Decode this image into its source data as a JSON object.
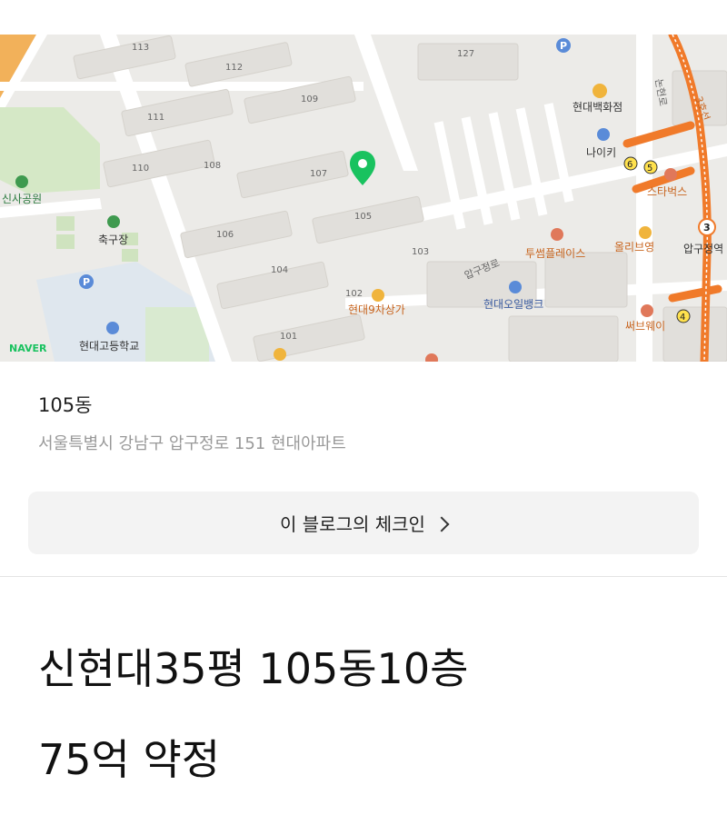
{
  "map": {
    "brand": "NAVER",
    "buildings": [
      "113",
      "112",
      "127",
      "109",
      "111",
      "110",
      "108",
      "107",
      "106",
      "105",
      "104",
      "103",
      "102",
      "101"
    ],
    "road_names": [
      "압구정로",
      "논현로",
      "3호선"
    ],
    "pois": {
      "park": "신사공원",
      "field": "축구장",
      "school": "현대고등학교",
      "dept_store": "현대백화점",
      "nike": "나이키",
      "starbucks": "스타벅스",
      "twosome": "투썸플레이스",
      "olive": "올리브영",
      "station": "압구정역",
      "mall": "현대9차상가",
      "oilbank": "현대오일뱅크",
      "subway": "써브웨이"
    },
    "exits": [
      "6",
      "5",
      "3",
      "4"
    ],
    "colors": {
      "marker": "#19c25f",
      "subway_line": "#f07a2a"
    }
  },
  "place": {
    "name": "105동",
    "address": "서울특별시 강남구 압구정로 151 현대아파트"
  },
  "checkin": {
    "label": "이 블로그의 체크인"
  },
  "post": {
    "line1": "신현대35평 105동10층",
    "line2": "75억 약정"
  }
}
